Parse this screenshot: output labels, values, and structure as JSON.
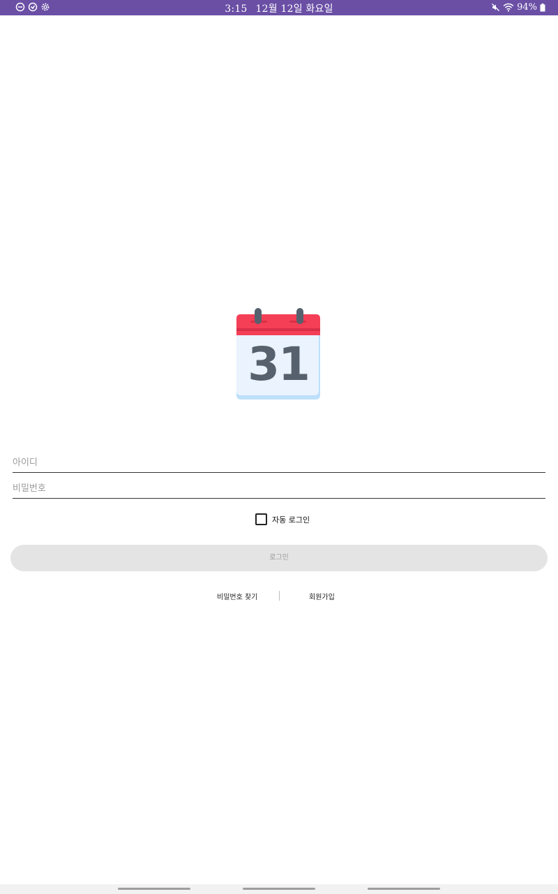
{
  "status_bar": {
    "time": "3:15",
    "date": "12월 12일 화요일",
    "battery": "94%",
    "background_color": "#6a4fa5",
    "left_icons": [
      "do-not-disturb-icon",
      "sync-icon",
      "settings-icon"
    ],
    "right_icons": [
      "mute-icon",
      "wifi-icon",
      "battery-icon"
    ]
  },
  "logo": {
    "day_number": "31",
    "icon": "calendar-icon",
    "colors": {
      "header": "#f43f56",
      "body": "#eaf3fe",
      "number": "#56616d",
      "base": "#bde0fb"
    }
  },
  "form": {
    "id_placeholder": "아이디",
    "id_value": "",
    "password_placeholder": "비밀번호",
    "password_value": "",
    "auto_login_label": "자동 로그인",
    "auto_login_checked": false,
    "login_button_label": "로그인"
  },
  "links": {
    "find_password": "비밀번호 찾기",
    "sign_up": "회원가입"
  },
  "nav_bar": {
    "items": [
      "recent-apps",
      "home",
      "back"
    ]
  }
}
